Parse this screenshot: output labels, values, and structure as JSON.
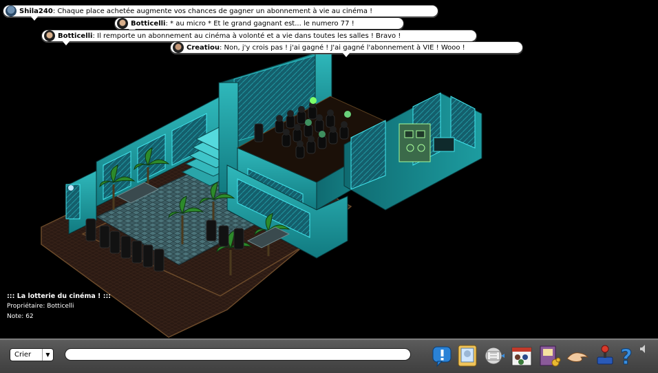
{
  "chat": [
    {
      "user": "Shila240",
      "message": ": Chaque place achetée augmente vos chances de gagner un abonnement à vie au cinéma !"
    },
    {
      "user": "Botticelli",
      "message": ": * au micro * Et le grand gagnant est... le numero 77 !"
    },
    {
      "user": "Botticelli",
      "message": ": Il remporte un abonnement au cinéma à volonté et a vie dans toutes les salles ! Bravo !"
    },
    {
      "user": "Creatiou",
      "message": ": Non, j'y crois pas ! j'ai gagné ! J'ai gagné l'abonnement à VIE ! Wooo !"
    }
  ],
  "room_info": {
    "name": "::: La lotterie du cinéma ! :::",
    "owner_label": "Propriétaire: ",
    "owner": "Botticelli",
    "rating_label": "Note: ",
    "rating": "62"
  },
  "toolbar": {
    "chat_mode": "Crier",
    "chat_input_value": "",
    "icons": [
      "help-alert-icon",
      "avatar-card-icon",
      "navigator-icon",
      "events-icon",
      "catalogue-icon",
      "hand-icon",
      "games-icon",
      "help-icon"
    ]
  },
  "colors": {
    "room_teal": "#1e9a9e",
    "room_dark_teal": "#0d5a62",
    "floor_brown": "#2a1a12",
    "toolbar": "#4c4c4c"
  }
}
